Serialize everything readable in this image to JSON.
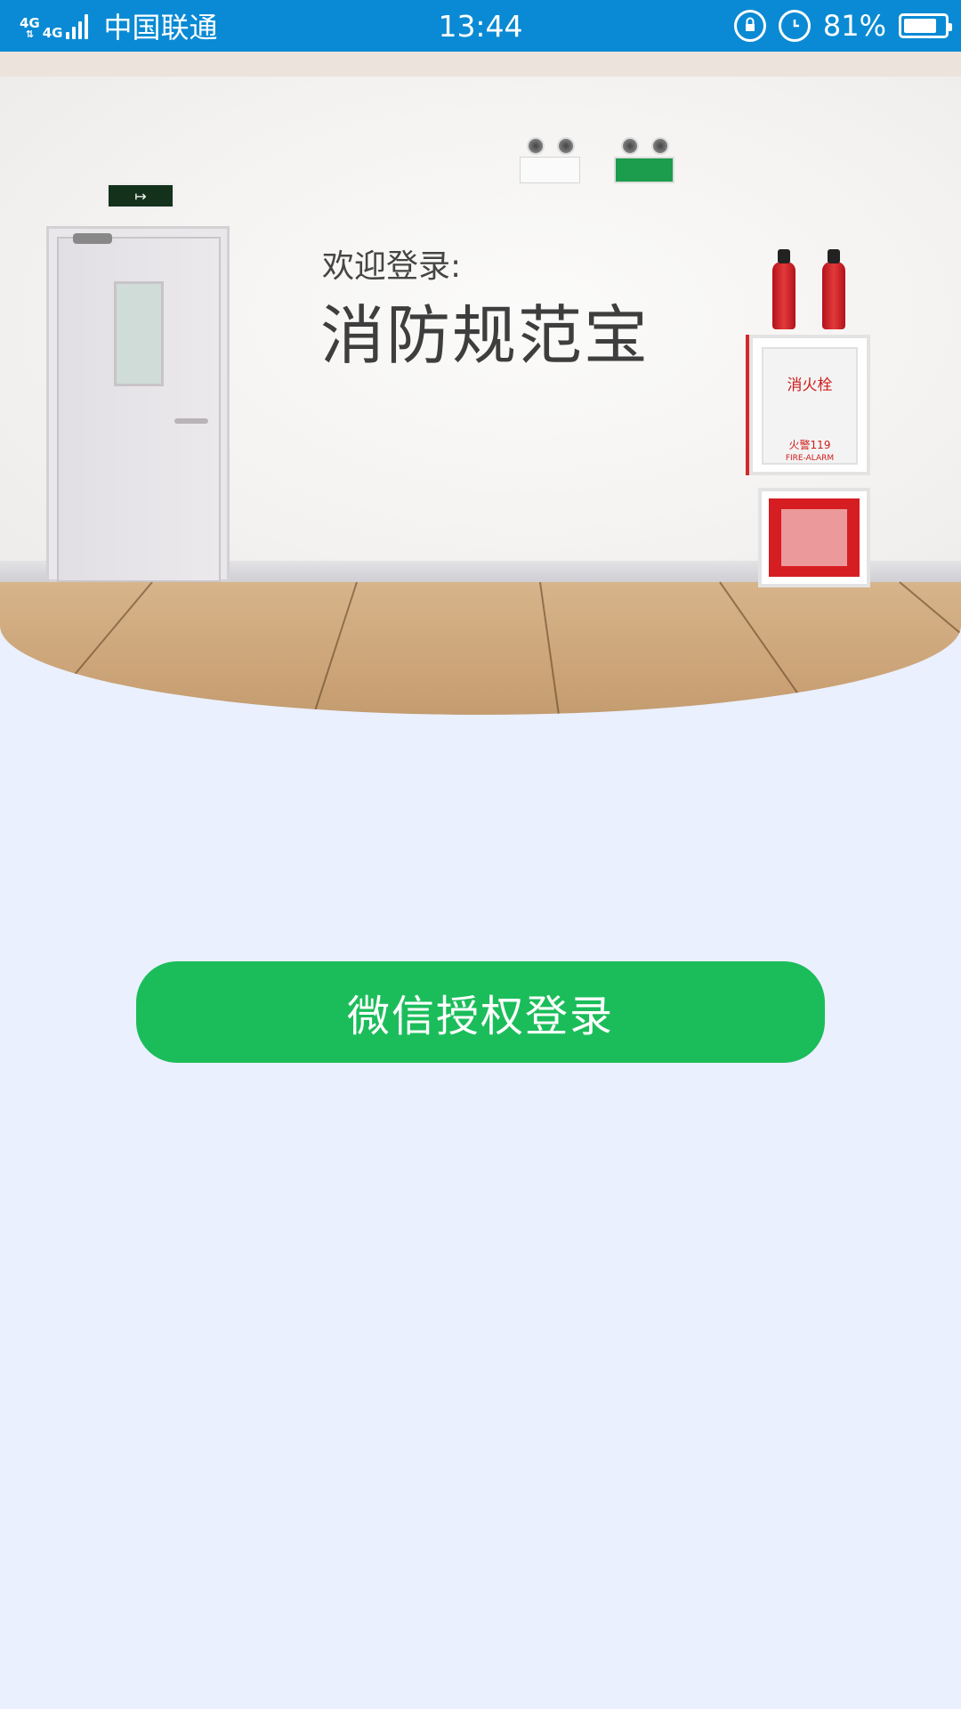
{
  "status_bar": {
    "network_type": "4G",
    "carrier": "中国联通",
    "time": "13:44",
    "battery_percent_label": "81%",
    "battery_level": 0.81,
    "icons": [
      "signal-icon",
      "rotation-lock-icon",
      "alarm-icon",
      "battery-icon"
    ]
  },
  "hero": {
    "welcome_text": "欢迎登录:",
    "app_name": "消防规范宝",
    "hydrant_label": "消火栓",
    "fire_alarm_label": "火警119",
    "fire_alarm_en": "FIRE-ALARM",
    "exit_sign_text": "↦"
  },
  "login": {
    "wechat_button_label": "微信授权登录"
  },
  "colors": {
    "status_bar_bg": "#0a8ad4",
    "page_bg": "#eaf0fe",
    "button_green": "#1bbd5a"
  }
}
